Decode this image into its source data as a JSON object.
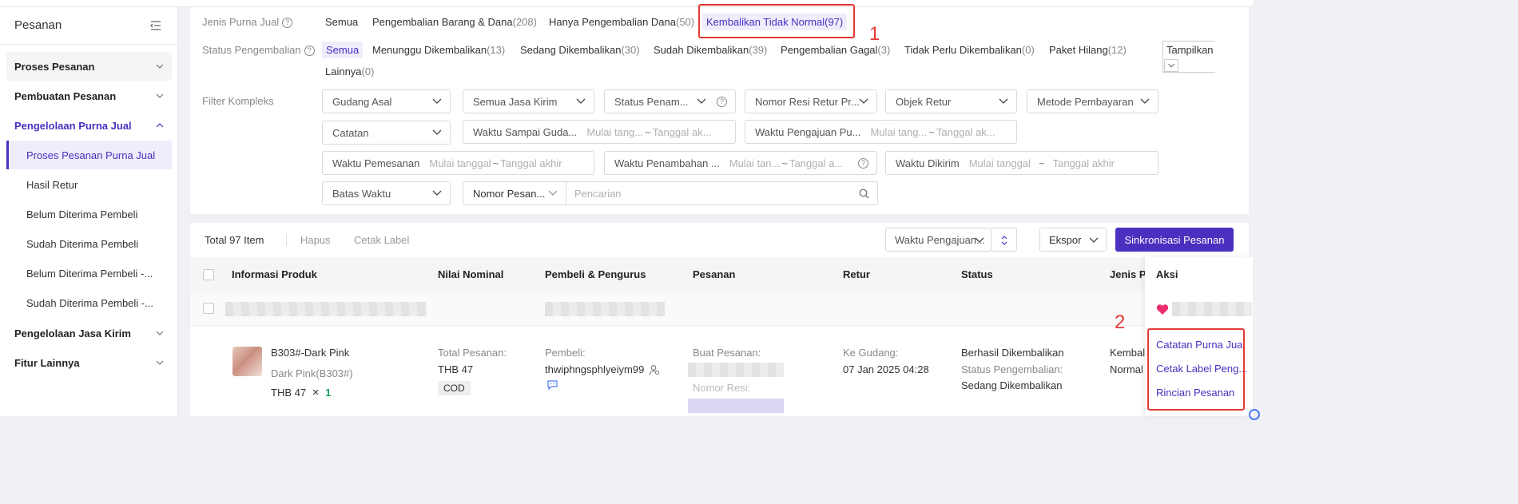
{
  "sidebar": {
    "title": "Pesanan",
    "items": [
      {
        "label": "Proses Pesanan"
      },
      {
        "label": "Pembuatan Pesanan"
      },
      {
        "label": "Pengelolaan Purna Jual"
      },
      {
        "label": "Pengelolaan Jasa Kirim"
      },
      {
        "label": "Fitur Lainnya"
      }
    ],
    "subitems": [
      {
        "label": "Proses Pesanan Purna Jual"
      },
      {
        "label": "Hasil Retur"
      },
      {
        "label": "Belum Diterima Pembeli"
      },
      {
        "label": "Sudah Diterima Pembeli"
      },
      {
        "label": "Belum Diterima Pembeli -..."
      },
      {
        "label": "Sudah Diterima Pembeli -..."
      }
    ]
  },
  "filters": {
    "jenis_label": "Jenis Purna Jual",
    "jenis_tabs": [
      {
        "label": "Semua",
        "count": ""
      },
      {
        "label": "Pengembalian Barang & Dana",
        "count": "(208)"
      },
      {
        "label": "Hanya Pengembalian Dana",
        "count": "(50)"
      },
      {
        "label": "Kembalikan Tidak Normal",
        "count": "(97)"
      }
    ],
    "status_label": "Status Pengembalian",
    "status_tabs": [
      {
        "label": "Semua",
        "count": ""
      },
      {
        "label": "Menunggu Dikembalikan",
        "count": "(13)"
      },
      {
        "label": "Sedang Dikembalikan",
        "count": "(30)"
      },
      {
        "label": "Sudah Dikembalikan",
        "count": "(39)"
      },
      {
        "label": "Pengembalian Gagal",
        "count": "(3)"
      },
      {
        "label": "Tidak Perlu Dikembalikan",
        "count": "(0)"
      },
      {
        "label": "Paket Hilang",
        "count": "(12)"
      },
      {
        "label": "Lainnya",
        "count": "(0)"
      }
    ],
    "tampilkan_label": "Tampilkan",
    "kompleks_label": "Filter Kompleks",
    "dropdowns": {
      "gudang_asal": "Gudang Asal",
      "jasa_kirim": "Semua Jasa Kirim",
      "status_penam": "Status Penam...",
      "nomor_resi": "Nomor Resi Retur Pr...",
      "objek_retur": "Objek Retur",
      "metode_pembayaran": "Metode Pembayaran",
      "catatan": "Catatan",
      "batas_waktu": "Batas Waktu",
      "nomor_pesan": "Nomor Pesan..."
    },
    "date_ranges": {
      "sampai_gudang": {
        "label": "Waktu Sampai Guda...",
        "start": "Mulai tang...",
        "end": "Tanggal ak..."
      },
      "pengajuan": {
        "label": "Waktu Pengajuan Pu...",
        "start": "Mulai tang...",
        "end": "Tanggal ak..."
      },
      "pemesanan": {
        "label": "Waktu Pemesanan",
        "start": "Mulai tanggal",
        "end": "Tanggal akhir"
      },
      "penambahan": {
        "label": "Waktu Penambahan ...",
        "start": "Mulai tan...",
        "end": "Tanggal a..."
      },
      "dikirim": {
        "label": "Waktu Dikirim",
        "start": "Mulai tanggal",
        "end": "Tanggal akhir"
      }
    },
    "tilde": "~",
    "search_placeholder": "Pencarian"
  },
  "annotations": {
    "one": "1",
    "two": "2"
  },
  "table": {
    "total": "Total 97 Item",
    "hapus": "Hapus",
    "cetak_label": "Cetak Label",
    "sort_label": "Waktu Pengajuan...",
    "ekspor": "Ekspor",
    "sinkronisasi": "Sinkronisasi Pesanan",
    "headers": {
      "produk": "Informasi Produk",
      "nominal": "Nilai Nominal",
      "pembeli": "Pembeli & Pengurus",
      "pesanan": "Pesanan",
      "retur": "Retur",
      "status": "Status",
      "jenis": "Jenis Pu",
      "aksi": "Aksi"
    },
    "row": {
      "product_name": "B303#-Dark Pink",
      "variant": "Dark Pink(B303#)",
      "price": "THB 47",
      "times": "×",
      "qty": "1",
      "total_label": "Total Pesanan:",
      "total_value": "THB 47",
      "payment": "COD",
      "buyer_label": "Pembeli:",
      "buyer_name": "thwiphngsphlyeiym99",
      "buat_pesanan": "Buat Pesanan:",
      "nomor_resi": "Nomor Resi:",
      "ke_gudang": "Ke Gudang:",
      "gudang_time": "07 Jan 2025 04:28",
      "status_main": "Berhasil Dikembalikan",
      "status_sub_label": "Status Pengembalian:",
      "status_sub_value": "Sedang Dikembalikan",
      "jenis_1": "Kembal",
      "jenis_2": "Normal"
    },
    "actions": {
      "catatan": "Catatan Purna Jual",
      "cetak": "Cetak Label Peng...",
      "rincian": "Rincian Pesanan"
    }
  },
  "colors": {
    "accent": "#4b2fbf",
    "annotation": "#e53935"
  }
}
